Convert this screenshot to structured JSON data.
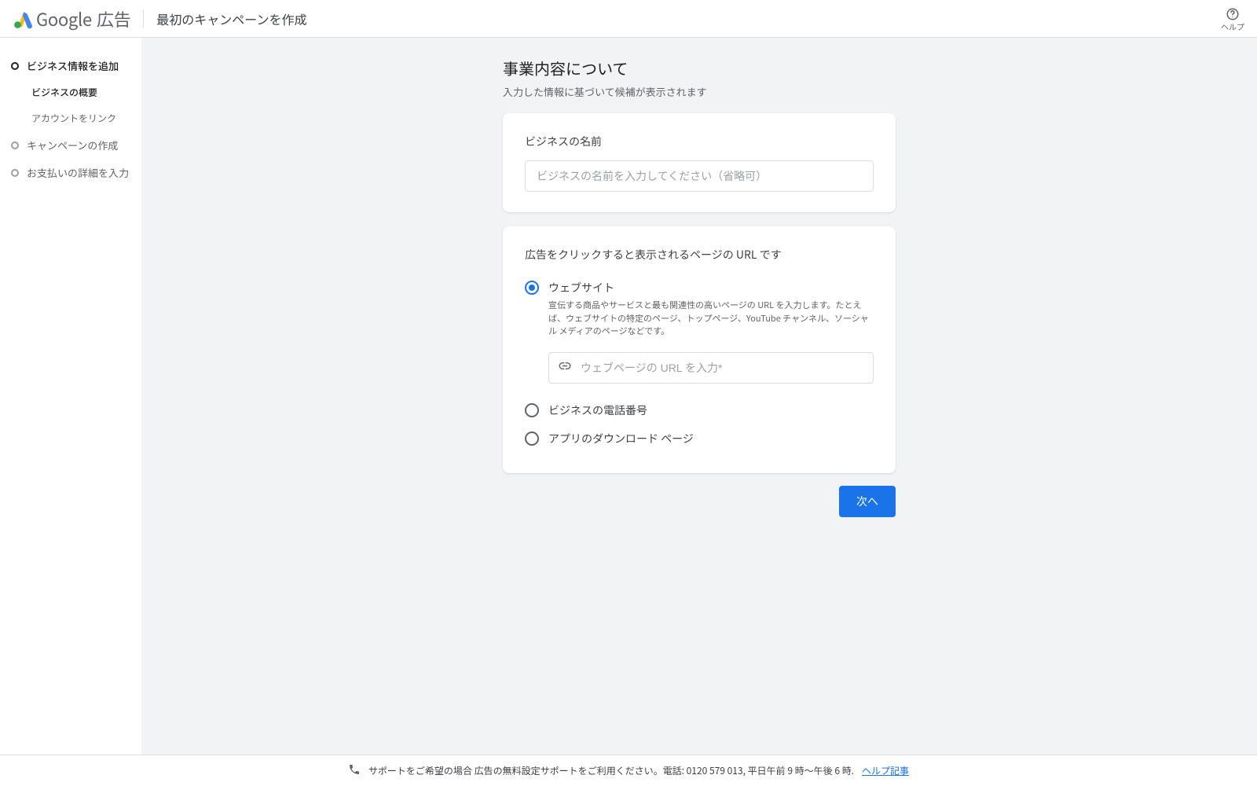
{
  "header": {
    "product_google": "Google",
    "product_ads": "広告",
    "page_title": "最初のキャンペーンを作成",
    "help_label": "ヘルプ"
  },
  "sidebar": {
    "steps": [
      {
        "label": "ビジネス情報を追加",
        "active": true
      },
      {
        "label": "キャンペーンの作成",
        "active": false
      },
      {
        "label": "お支払いの詳細を入力",
        "active": false
      }
    ],
    "substeps": [
      {
        "label": "ビジネスの概要",
        "active": true
      },
      {
        "label": "アカウントをリンク",
        "active": false
      }
    ]
  },
  "main": {
    "title": "事業内容について",
    "subtitle": "入力した情報に基づいて候補が表示されます",
    "name_card": {
      "label": "ビジネスの名前",
      "placeholder": "ビジネスの名前を入力してください（省略可）"
    },
    "url_card": {
      "heading": "広告をクリックすると表示されるページの URL です",
      "options": [
        {
          "key": "website",
          "label": "ウェブサイト",
          "selected": true,
          "help": "宣伝する商品やサービスと最も関連性の高いページの URL を入力します。たとえば、ウェブサイトの特定のページ、トップページ、YouTube チャンネル、ソーシャル メディアのページなどです。",
          "url_placeholder": "ウェブページの URL を入力*"
        },
        {
          "key": "phone",
          "label": "ビジネスの電話番号",
          "selected": false
        },
        {
          "key": "app",
          "label": "アプリのダウンロード ページ",
          "selected": false
        }
      ]
    },
    "next_button": "次へ"
  },
  "footer": {
    "text": "サポートをご希望の場合 広告の無料設定サポートをご利用ください。電話: 0120 579 013, 平日午前 9 時～午後 6 時.",
    "link": "ヘルプ記事"
  },
  "colors": {
    "primary": "#1a73e8",
    "surface": "#f1f3f4",
    "border": "#dadce0"
  }
}
